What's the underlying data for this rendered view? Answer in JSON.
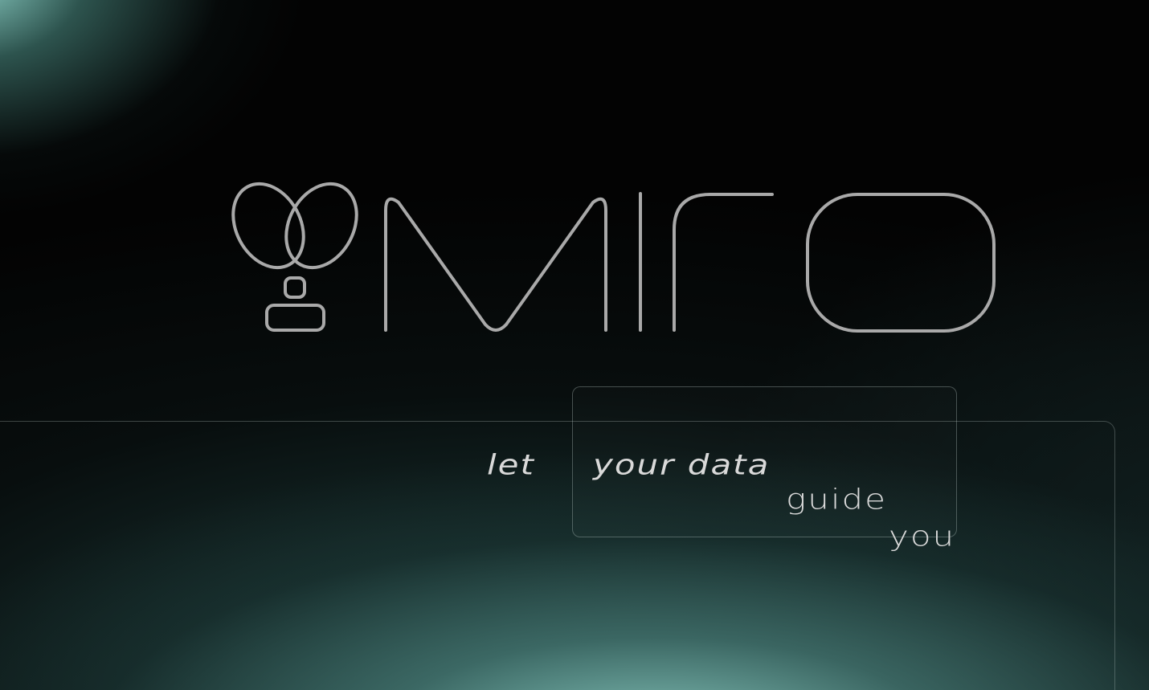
{
  "brand": {
    "wordmark": "miro",
    "logo_icon": "butterfly-person-icon",
    "line_color": "#a9a9a9"
  },
  "tagline": {
    "word_1": "let",
    "word_2": "your data",
    "word_3": "guide",
    "word_4": "you"
  },
  "colors": {
    "background": "#030303",
    "accent_glow": "#8fd6cc",
    "text": "#d9d9d9"
  }
}
